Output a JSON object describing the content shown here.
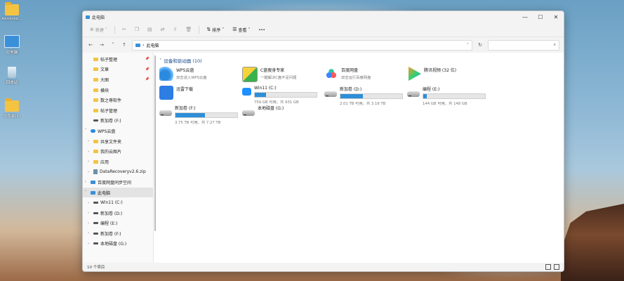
{
  "desktop": {
    "icons": [
      {
        "label": "Administ..."
      },
      {
        "label": "此电脑"
      },
      {
        "label": "回收站"
      },
      {
        "label": "文件夹(1)"
      }
    ]
  },
  "window": {
    "title": "此电脑",
    "controls": {
      "minimize": "—",
      "maximize": "☐",
      "close": "✕"
    },
    "toolbar": {
      "new": "新建",
      "sort": "排序",
      "view": "查看",
      "more": "···"
    },
    "address": {
      "path_sep": "›",
      "path": "此电脑"
    },
    "search": {
      "icon": "⌕"
    }
  },
  "sidebar": [
    {
      "label": "帖子整理",
      "pin": true,
      "type": "folder",
      "indent": 1
    },
    {
      "label": "文章",
      "pin": true,
      "type": "folder",
      "indent": 1
    },
    {
      "label": "大图",
      "pin": true,
      "type": "folder",
      "indent": 1
    },
    {
      "label": "横块",
      "pin": false,
      "type": "folder",
      "indent": 1
    },
    {
      "label": "数之尊软件",
      "pin": false,
      "type": "folder",
      "indent": 1
    },
    {
      "label": "帖子管理",
      "pin": false,
      "type": "folder",
      "indent": 1
    },
    {
      "label": "新加卷 (F:)",
      "pin": false,
      "type": "drive",
      "indent": 1
    },
    {
      "label": "WPS云盘",
      "type": "cloud",
      "arrow": "v",
      "indent": 0
    },
    {
      "label": "共享文件夹",
      "type": "folder",
      "arrow": ">",
      "indent": 1
    },
    {
      "label": "我的云图片",
      "type": "folder",
      "arrow": ">",
      "indent": 1
    },
    {
      "label": "应用",
      "type": "folder",
      "arrow": ">",
      "indent": 1
    },
    {
      "label": "DataRecoveryv2.6.zip",
      "type": "zip",
      "arrow": ">",
      "indent": 1
    },
    {
      "label": "百度网盘同步空间",
      "type": "pc",
      "arrow": ">",
      "indent": 0
    },
    {
      "label": "此电脑",
      "type": "pc",
      "arrow": "v",
      "indent": 0,
      "selected": true
    },
    {
      "label": "Win11 (C:)",
      "type": "drive",
      "arrow": ">",
      "indent": 1
    },
    {
      "label": "新加卷 (D:)",
      "type": "drive",
      "arrow": ">",
      "indent": 1
    },
    {
      "label": "编程 (E:)",
      "type": "drive",
      "arrow": ">",
      "indent": 1
    },
    {
      "label": "新加卷 (F:)",
      "type": "drive",
      "arrow": ">",
      "indent": 1
    },
    {
      "label": "本地磁盘 (G:)",
      "type": "drive",
      "arrow": ">",
      "indent": 1
    }
  ],
  "section": {
    "title": "设备和驱动器 (10)"
  },
  "tiles": [
    {
      "name": "WPS云盘",
      "sub": "双击进入WPS云盘",
      "kind": "wps"
    },
    {
      "name": "C盘瘦身专家",
      "sub": "一键解决C盘不足问题",
      "kind": "clean"
    },
    {
      "name": "百度网盘",
      "sub": "双击运行百度网盘",
      "kind": "baidu"
    },
    {
      "name": "腾讯视频 (32 位)",
      "sub": "",
      "kind": "tencent"
    },
    {
      "name": "迅雷下载",
      "sub": "",
      "kind": "xunlei"
    },
    {
      "name": "Win11 (C:)",
      "sub": "759 GB 可用，共 931 GB",
      "kind": "win",
      "used": 0.18
    },
    {
      "name": "新加卷 (D:)",
      "sub": "2.01 TB 可用，共 3.16 TB",
      "kind": "drive",
      "used": 0.36
    },
    {
      "name": "编程 (E:)",
      "sub": "144 GB 可用，共 148 GB",
      "kind": "drive",
      "used": 0.06
    },
    {
      "name": "新加卷 (F:)",
      "sub": "3.75 TB 可用，共 7.27 TB",
      "kind": "drive",
      "used": 0.48
    },
    {
      "name": "本地磁盘 (G:)",
      "sub": "",
      "kind": "drive"
    }
  ],
  "status": {
    "count": "10 个项目"
  }
}
